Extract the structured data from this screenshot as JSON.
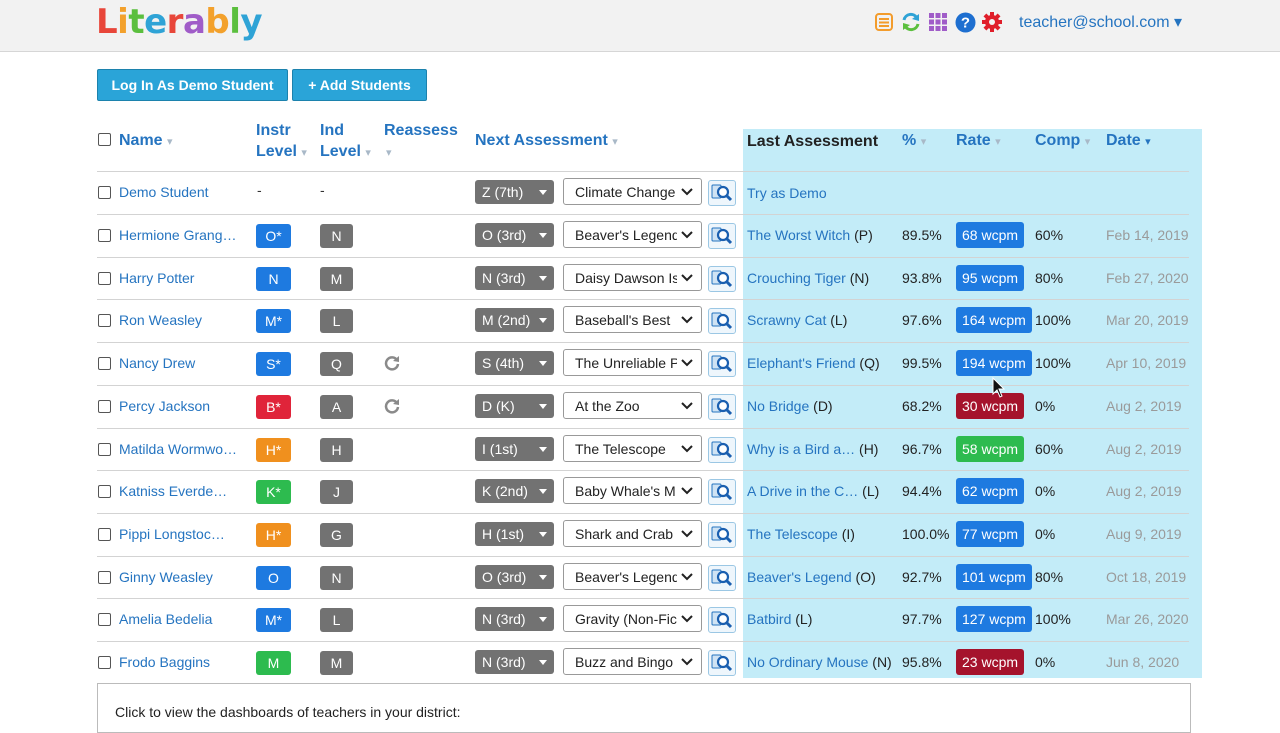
{
  "header": {
    "logo_letters": [
      "L",
      "i",
      "t",
      "e",
      "r",
      "a",
      "b",
      "l",
      "y"
    ],
    "logo_colors": [
      "#e8463a",
      "#f3a12c",
      "#5bbf3e",
      "#2fa3d6",
      "#e8463a",
      "#a05cc8",
      "#f3a12c",
      "#5bbf3e",
      "#2fa3d6"
    ],
    "account": "teacher@school.com ▾",
    "icons": [
      "list-icon",
      "sync-icon",
      "grid-icon",
      "help-icon",
      "settings-icon"
    ]
  },
  "toolbar": {
    "demo_label": "Log In As Demo Student",
    "add_label": "+  Add Students"
  },
  "columns": {
    "name": "Name",
    "instr_1": "Instr",
    "instr_2": "Level",
    "ind_1": "Ind",
    "ind_2": "Level",
    "reassess": "Reassess",
    "next": "Next Assessment",
    "last": "Last Assessment",
    "pct": "%",
    "rate": "Rate",
    "comp": "Comp",
    "date": "Date",
    "sort_arrow": "▾",
    "date_arrow": "▾"
  },
  "demo_row": {
    "name": "Demo Student",
    "instr": "-",
    "ind": "-",
    "next": "Z (7th)",
    "book": "Climate Change",
    "last": "Try as Demo"
  },
  "students": [
    {
      "name": "Hermione Grang…",
      "instr": "O*",
      "instr_color": "#1e7ae0",
      "ind": "N",
      "reassess": false,
      "next": "O (3rd)",
      "book": "Beaver's Legend",
      "last": "The Worst Witch",
      "last_level": "(P)",
      "pct": "89.5%",
      "rate": "68 wcpm",
      "rate_color": "#1e7ae0",
      "comp": "60%",
      "date": "Feb 14, 2019"
    },
    {
      "name": "Harry Potter",
      "instr": "N",
      "instr_color": "#1e7ae0",
      "ind": "M",
      "reassess": false,
      "next": "N (3rd)",
      "book": "Daisy Dawson Is",
      "last": "Crouching Tiger",
      "last_level": "(N)",
      "pct": "93.8%",
      "rate": "95 wcpm",
      "rate_color": "#1e7ae0",
      "comp": "80%",
      "date": "Feb 27, 2020"
    },
    {
      "name": "Ron Weasley",
      "instr": "M*",
      "instr_color": "#1e7ae0",
      "ind": "L",
      "reassess": false,
      "next": "M (2nd)",
      "book": "Baseball's Best",
      "last": "Scrawny Cat",
      "last_level": "(L)",
      "pct": "97.6%",
      "rate": "164 wcpm",
      "rate_color": "#1e7ae0",
      "comp": "100%",
      "date": "Mar 20, 2019"
    },
    {
      "name": "Nancy Drew",
      "instr": "S*",
      "instr_color": "#1e7ae0",
      "ind": "Q",
      "reassess": true,
      "next": "S (4th)",
      "book": "The Unreliable P",
      "last": "Elephant's Friend",
      "last_level": "(Q)",
      "pct": "99.5%",
      "rate": "194 wcpm",
      "rate_color": "#1e7ae0",
      "comp": "100%",
      "date": "Apr 10, 2019"
    },
    {
      "name": "Percy Jackson",
      "instr": "B*",
      "instr_color": "#e0243a",
      "ind": "A",
      "reassess": true,
      "next": "D (K)",
      "book": "At the Zoo",
      "last": "No Bridge",
      "last_level": "(D)",
      "pct": "68.2%",
      "rate": "30 wcpm",
      "rate_color": "#a5132c",
      "comp": "0%",
      "date": "Aug 2, 2019"
    },
    {
      "name": "Matilda Wormwo…",
      "instr": "H*",
      "instr_color": "#f0901e",
      "ind": "H",
      "reassess": false,
      "next": "I (1st)",
      "book": "The Telescope",
      "last": "Why is a Bird a…",
      "last_level": "(H)",
      "pct": "96.7%",
      "rate": "58 wcpm",
      "rate_color": "#2dbb4f",
      "comp": "60%",
      "date": "Aug 2, 2019"
    },
    {
      "name": "Katniss Everde…",
      "instr": "K*",
      "instr_color": "#2dbb4f",
      "ind": "J",
      "reassess": false,
      "next": "K (2nd)",
      "book": "Baby Whale's M",
      "last": "A Drive in the C…",
      "last_level": "(L)",
      "pct": "94.4%",
      "rate": "62 wcpm",
      "rate_color": "#1e7ae0",
      "comp": "0%",
      "date": "Aug 2, 2019"
    },
    {
      "name": "Pippi Longstoc…",
      "instr": "H*",
      "instr_color": "#f0901e",
      "ind": "G",
      "reassess": false,
      "next": "H (1st)",
      "book": "Shark and Crab",
      "last": "The Telescope",
      "last_level": "(I)",
      "pct": "100.0%",
      "rate": "77 wcpm",
      "rate_color": "#1e7ae0",
      "comp": "0%",
      "date": "Aug 9, 2019"
    },
    {
      "name": "Ginny Weasley",
      "instr": "O",
      "instr_color": "#1e7ae0",
      "ind": "N",
      "reassess": false,
      "next": "O (3rd)",
      "book": "Beaver's Legend",
      "last": "Beaver's Legend",
      "last_level": "(O)",
      "pct": "92.7%",
      "rate": "101 wcpm",
      "rate_color": "#1e7ae0",
      "comp": "80%",
      "date": "Oct 18, 2019"
    },
    {
      "name": "Amelia Bedelia",
      "instr": "M*",
      "instr_color": "#1e7ae0",
      "ind": "L",
      "reassess": false,
      "next": "N (3rd)",
      "book": "Gravity (Non-Fic",
      "last": "Batbird",
      "last_level": "(L)",
      "pct": "97.7%",
      "rate": "127 wcpm",
      "rate_color": "#1e7ae0",
      "comp": "100%",
      "date": "Mar 26, 2020"
    },
    {
      "name": "Frodo Baggins",
      "instr": "M",
      "instr_color": "#2dbb4f",
      "ind": "M",
      "reassess": false,
      "next": "N (3rd)",
      "book": "Buzz and Bingo i",
      "last": "No Ordinary Mouse",
      "last_level": "(N)",
      "pct": "95.8%",
      "rate": "23 wcpm",
      "rate_color": "#a5132c",
      "comp": "0%",
      "date": "Jun 8, 2020"
    }
  ],
  "footer": {
    "district_text": "Click to view the dashboards of teachers in your district:"
  }
}
